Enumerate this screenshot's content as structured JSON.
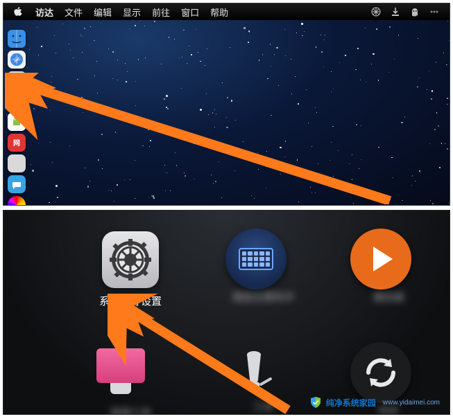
{
  "menubar": {
    "app": "访达",
    "items": [
      "文件",
      "编辑",
      "显示",
      "前往",
      "窗口",
      "帮助"
    ]
  },
  "dock_items": [
    {
      "name": "finder"
    },
    {
      "name": "safari"
    },
    {
      "name": "mail"
    },
    {
      "name": "launchpad"
    },
    {
      "name": "android"
    },
    {
      "name": "red-app"
    },
    {
      "name": "blank1"
    },
    {
      "name": "chat"
    },
    {
      "name": "color-picker"
    }
  ],
  "launchpad": {
    "apps": [
      {
        "id": "system-preferences",
        "label": "系统偏好设置"
      }
    ]
  },
  "watermark": {
    "brand": "纯净系统家园",
    "url": "www.yidaimei.com"
  }
}
